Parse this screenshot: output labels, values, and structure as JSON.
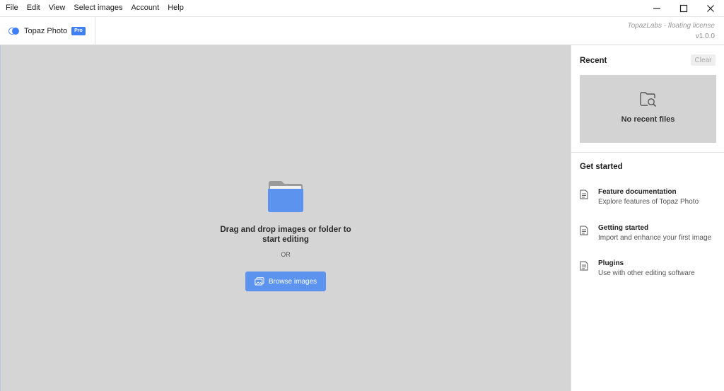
{
  "menubar": {
    "items": [
      "File",
      "Edit",
      "View",
      "Select images",
      "Account",
      "Help"
    ]
  },
  "window_controls": {
    "minimize_icon": "minimize-icon",
    "maximize_icon": "maximize-icon",
    "close_icon": "close-icon"
  },
  "header": {
    "app_name": "Topaz Photo",
    "badge": "Pro",
    "license": "TopazLabs - floating license",
    "version": "v1.0.0"
  },
  "dropzone": {
    "icon": "folder-icon",
    "message": "Drag and drop images or folder to start editing",
    "or_label": "OR",
    "browse_label": "Browse images"
  },
  "recent": {
    "title": "Recent",
    "clear_label": "Clear",
    "empty_icon": "folder-search-icon",
    "empty_label": "No recent files"
  },
  "get_started": {
    "title": "Get started",
    "items": [
      {
        "name": "Feature documentation",
        "description": "Explore features of Topaz Photo",
        "icon": "document-icon"
      },
      {
        "name": "Getting started",
        "description": "Import and enhance your first image",
        "icon": "document-icon"
      },
      {
        "name": "Plugins",
        "description": "Use with other editing software",
        "icon": "document-icon"
      }
    ]
  },
  "colors": {
    "accent": "#3f7ef5",
    "browse_button": "#5b93ef",
    "folder": "#5b93ef",
    "dropzone_bg": "#d5d5d5",
    "recent_box_bg": "#d3d3d3"
  }
}
